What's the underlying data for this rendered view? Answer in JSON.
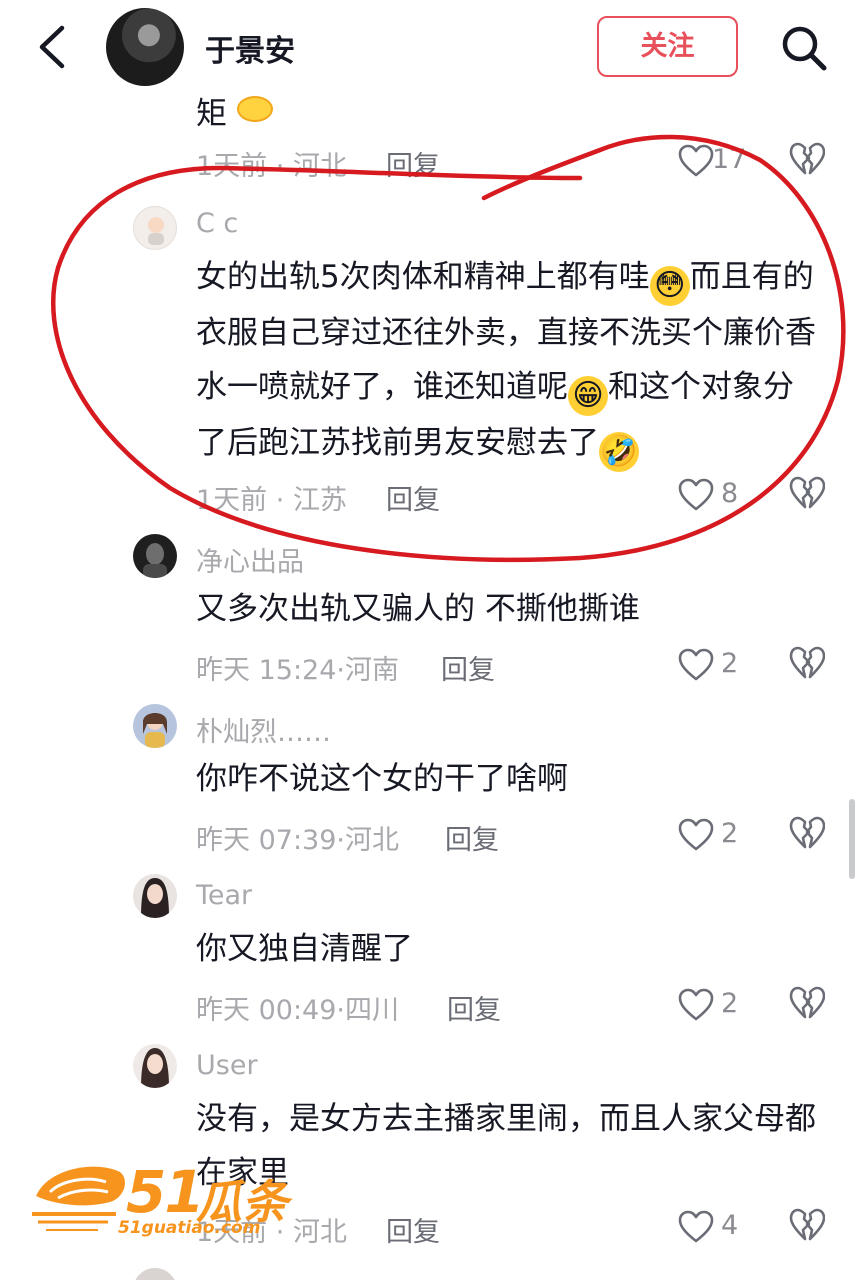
{
  "header": {
    "title": "于景安",
    "follow_label": "关注"
  },
  "comments": [
    {
      "text_partial": "矩",
      "time": "1天前",
      "location": "河北",
      "reply_label": "回复",
      "likes": "17"
    },
    {
      "username": "C c",
      "text_1": "女的出轨5次肉体和精神上都有哇",
      "text_2": "而且有的衣服自己穿过还往外卖，直接不洗买个廉价香水一喷就好了，谁还知道呢",
      "text_3": "和这个对象分了后跑江苏找前男友安慰去了",
      "time": "1天前",
      "location": "江苏",
      "reply_label": "回复",
      "likes": "8"
    },
    {
      "username": "净心出品",
      "text": "又多次出轨又骗人的 不撕他撕谁",
      "time": "昨天 15:24",
      "location": "河南",
      "reply_label": "回复",
      "likes": "2"
    },
    {
      "username": "朴灿烈……",
      "text": "你咋不说这个女的干了啥啊",
      "time": "昨天 07:39",
      "location": "河北",
      "reply_label": "回复",
      "likes": "2"
    },
    {
      "username": "Tear",
      "text": "你又独自清醒了",
      "time": "昨天 00:49",
      "location": "四川",
      "reply_label": "回复",
      "likes": "2"
    },
    {
      "username": "User",
      "text": "没有，是女方去主播家里闹，而且人家父母都在家里",
      "time": "1天前",
      "location": "河北",
      "reply_label": "回复",
      "likes": "4"
    }
  ],
  "separator": "·",
  "watermark": {
    "number": "51",
    "brand": "瓜条",
    "site": "51guatiao.com"
  },
  "icons": {
    "back": "chevron-left-icon",
    "search": "search-icon",
    "like": "heart-outline-icon",
    "dislike": "broken-heart-icon"
  },
  "colors": {
    "accent": "#e8505b",
    "annotation": "#d61a1f",
    "watermark": "#f7941d",
    "meta_text": "#a8a9ad"
  }
}
